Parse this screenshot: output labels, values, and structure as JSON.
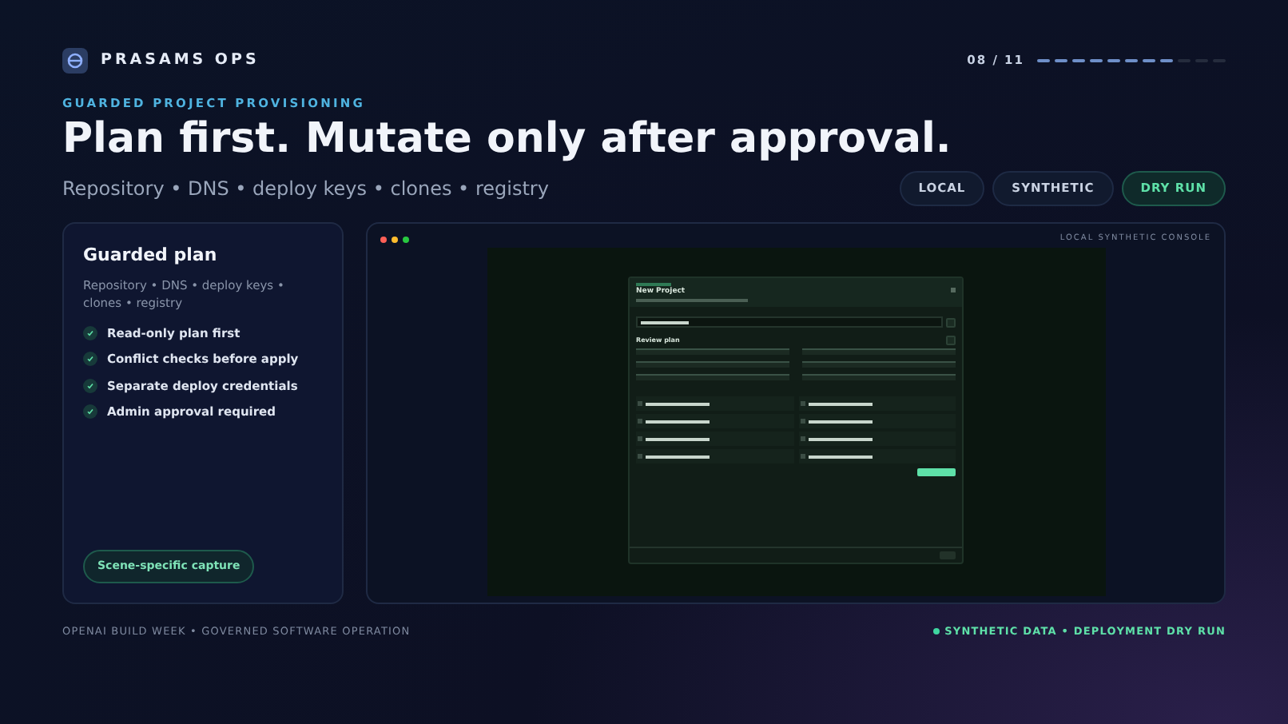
{
  "brand": {
    "name": "PRASAMS OPS"
  },
  "progress": {
    "label": "08 / 11",
    "steps": [
      {
        "done": true
      },
      {
        "done": true
      },
      {
        "done": true
      },
      {
        "done": true
      },
      {
        "done": true
      },
      {
        "done": true
      },
      {
        "done": true
      },
      {
        "done": true
      },
      {
        "done": false
      },
      {
        "done": false
      },
      {
        "done": false
      }
    ]
  },
  "eyebrow": "GUARDED PROJECT PROVISIONING",
  "headline": "Plan first. Mutate only after approval.",
  "subtitle": "Repository • DNS • deploy keys • clones • registry",
  "pills": [
    {
      "label": "LOCAL",
      "active": false
    },
    {
      "label": "SYNTHETIC",
      "active": false
    },
    {
      "label": "DRY RUN",
      "active": true
    }
  ],
  "card": {
    "title": "Guarded plan",
    "subtitle": "Repository • DNS • deploy keys • clones • registry",
    "checks": [
      "Read-only plan first",
      "Conflict checks before apply",
      "Separate deploy credentials",
      "Admin approval required"
    ],
    "tag": "Scene-specific capture"
  },
  "console": {
    "label": "LOCAL SYNTHETIC CONSOLE",
    "modal": {
      "title": "New Project",
      "review_title": "Review plan"
    }
  },
  "footer": {
    "left": "OPENAI BUILD WEEK • GOVERNED SOFTWARE OPERATION",
    "right": "SYNTHETIC DATA • DEPLOYMENT DRY RUN"
  }
}
